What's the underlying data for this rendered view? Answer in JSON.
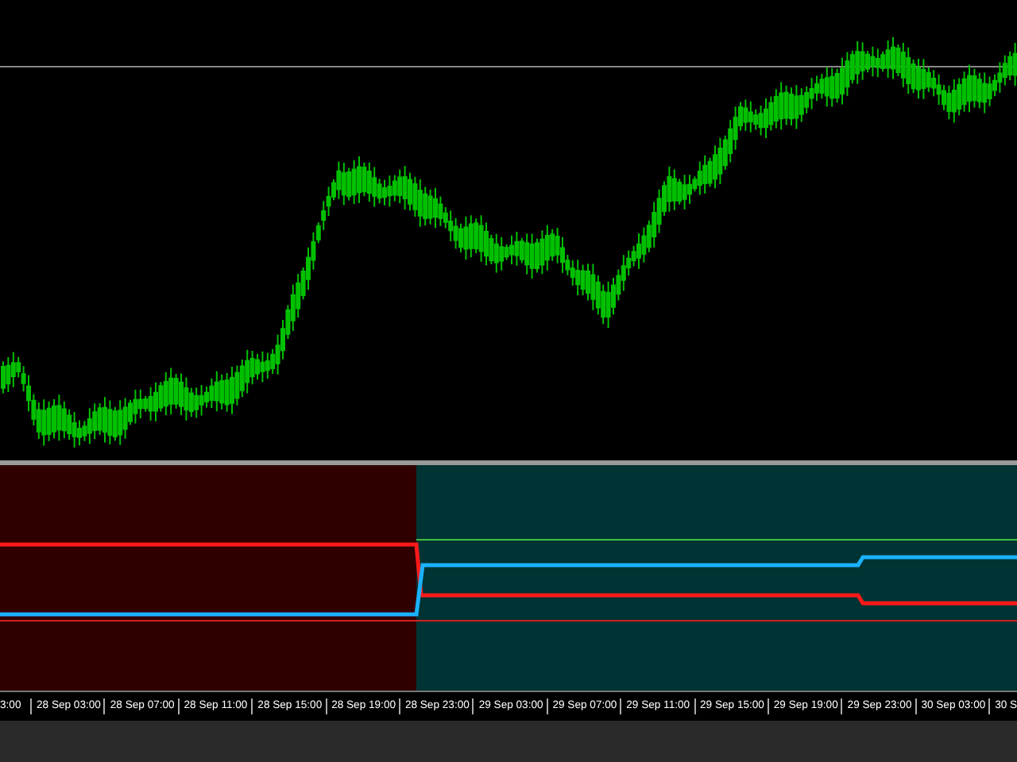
{
  "time_axis": {
    "labels": [
      "3:00",
      "28 Sep 03:00",
      "28 Sep 07:00",
      "28 Sep 11:00",
      "28 Sep 15:00",
      "28 Sep 19:00",
      "28 Sep 23:00",
      "29 Sep 03:00",
      "29 Sep 07:00",
      "29 Sep 11:00",
      "29 Sep 15:00",
      "29 Sep 19:00",
      "29 Sep 23:00",
      "30 Sep 03:00",
      "30 S"
    ]
  }
}
